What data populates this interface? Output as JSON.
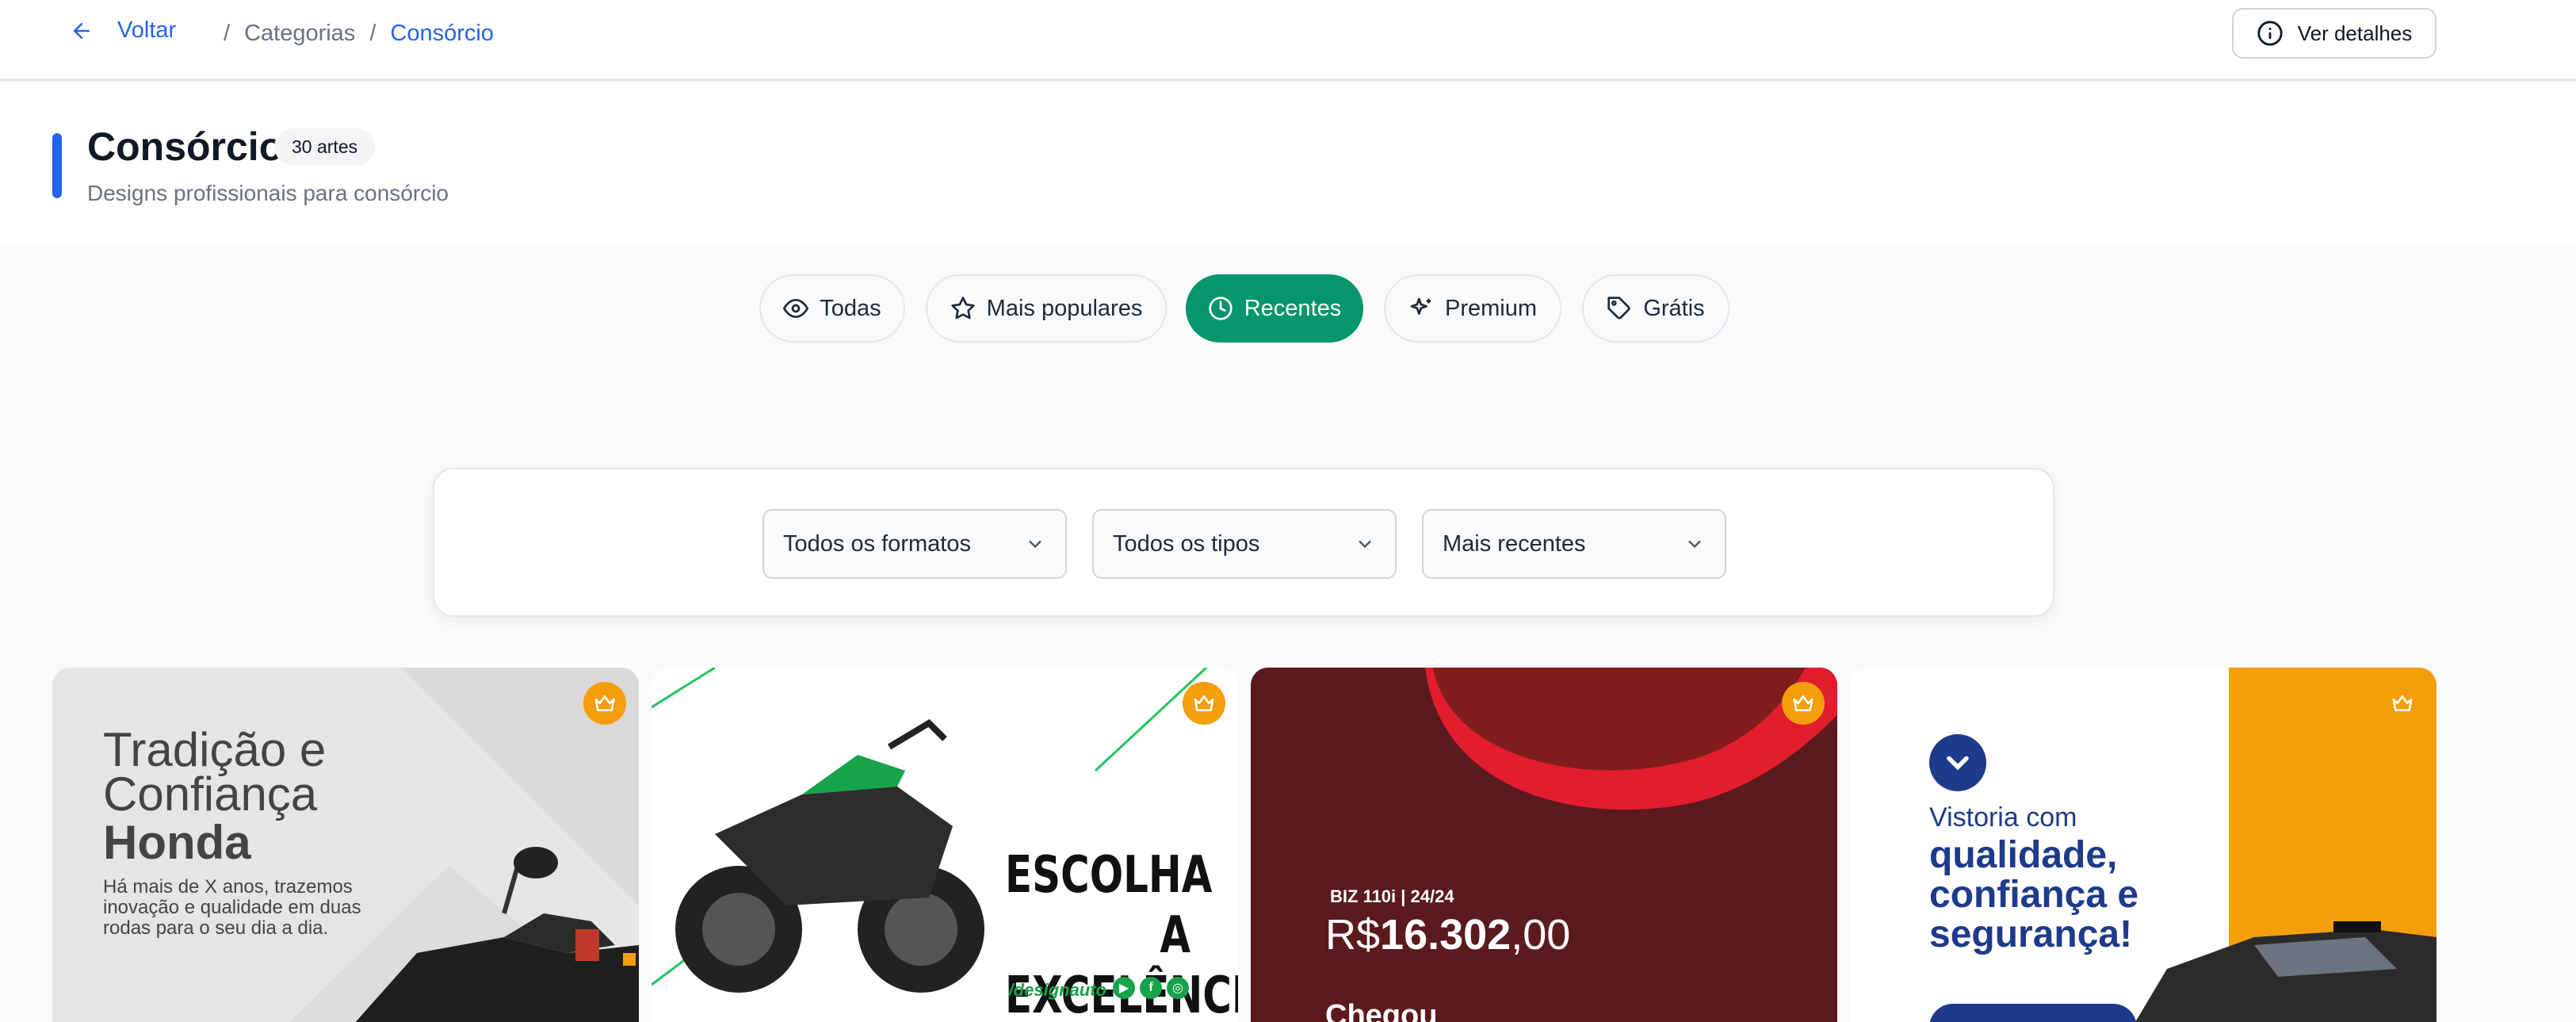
{
  "nav": {
    "back_label": "Voltar",
    "breadcrumbs": [
      "/",
      "Categorias",
      "/",
      "Consórcio"
    ],
    "details_label": "Ver detalhes"
  },
  "header": {
    "title": "Consórcio",
    "count": "30 artes",
    "subtitle": "Designs profissionais para consórcio"
  },
  "tabs": [
    {
      "label": "Todas",
      "icon": "eye-icon",
      "active": false
    },
    {
      "label": "Mais populares",
      "icon": "star-icon",
      "active": false
    },
    {
      "label": "Recentes",
      "icon": "clock-icon",
      "active": true
    },
    {
      "label": "Premium",
      "icon": "sparkles-icon",
      "active": false
    },
    {
      "label": "Grátis",
      "icon": "tag-icon",
      "active": false
    }
  ],
  "filters": {
    "format": "Todos os formatos",
    "type": "Todos os tipos",
    "sort": "Mais recentes"
  },
  "cards": [
    {
      "line1": "Tradição e",
      "line2": "Confiança",
      "line3": "Honda",
      "desc": "Há mais de X anos, trazemos inovação e qualidade em duas rodas para o seu dia a dia."
    },
    {
      "headline_1": "ESCOLHA A",
      "headline_2": "EXCELÊNCIA",
      "handle": "/designauto"
    },
    {
      "model": "BIZ 110i | 24/24",
      "price_prefix": "R$",
      "price_main": "16.302",
      "price_cents": ",00",
      "cta": "Chegou"
    },
    {
      "line1": "Vistoria com",
      "line2": "qualidade, confiança e segurança!"
    }
  ],
  "colors": {
    "accent_blue": "#2563eb",
    "active_tab": "#059669",
    "crown": "#f59e0b"
  }
}
